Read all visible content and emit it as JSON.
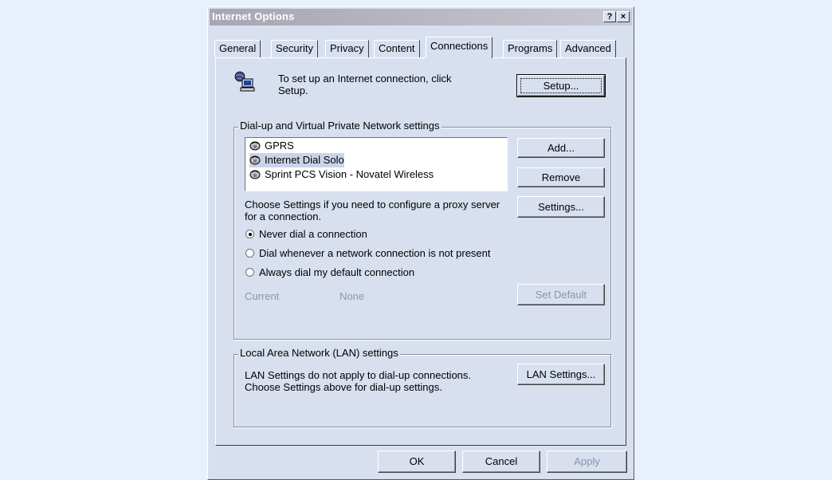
{
  "window": {
    "title": "Internet Options",
    "help_btn": "?",
    "close_btn": "×"
  },
  "tabs": [
    "General",
    "Security",
    "Privacy",
    "Content",
    "Connections",
    "Programs",
    "Advanced"
  ],
  "active_tab": "Connections",
  "setup": {
    "text": "To set up an Internet connection, click Setup.",
    "button": "Setup..."
  },
  "dialup": {
    "legend": "Dial-up and Virtual Private Network settings",
    "connections": [
      "GPRS",
      "Internet Dial Solo",
      "Sprint PCS Vision - Novatel Wireless"
    ],
    "selected": "Internet Dial Solo",
    "add_button": "Add...",
    "remove_button": "Remove",
    "settings_text": "Choose Settings if you need to configure a proxy server for a connection.",
    "settings_button": "Settings...",
    "radio_options": [
      "Never dial a connection",
      "Dial whenever a network connection is not present",
      "Always dial my default connection"
    ],
    "selected_option": "Never dial a connection",
    "current_label": "Current",
    "current_value": "None",
    "set_default_button": "Set Default"
  },
  "lan": {
    "legend": "Local Area Network (LAN) settings",
    "text": "LAN Settings do not apply to dial-up connections. Choose Settings above for dial-up settings.",
    "button": "LAN Settings..."
  },
  "footer": {
    "ok": "OK",
    "cancel": "Cancel",
    "apply": "Apply"
  },
  "icons": {
    "connection_wizard": "globe-computer-icon",
    "dialup_connection": "phone-modem-icon"
  }
}
